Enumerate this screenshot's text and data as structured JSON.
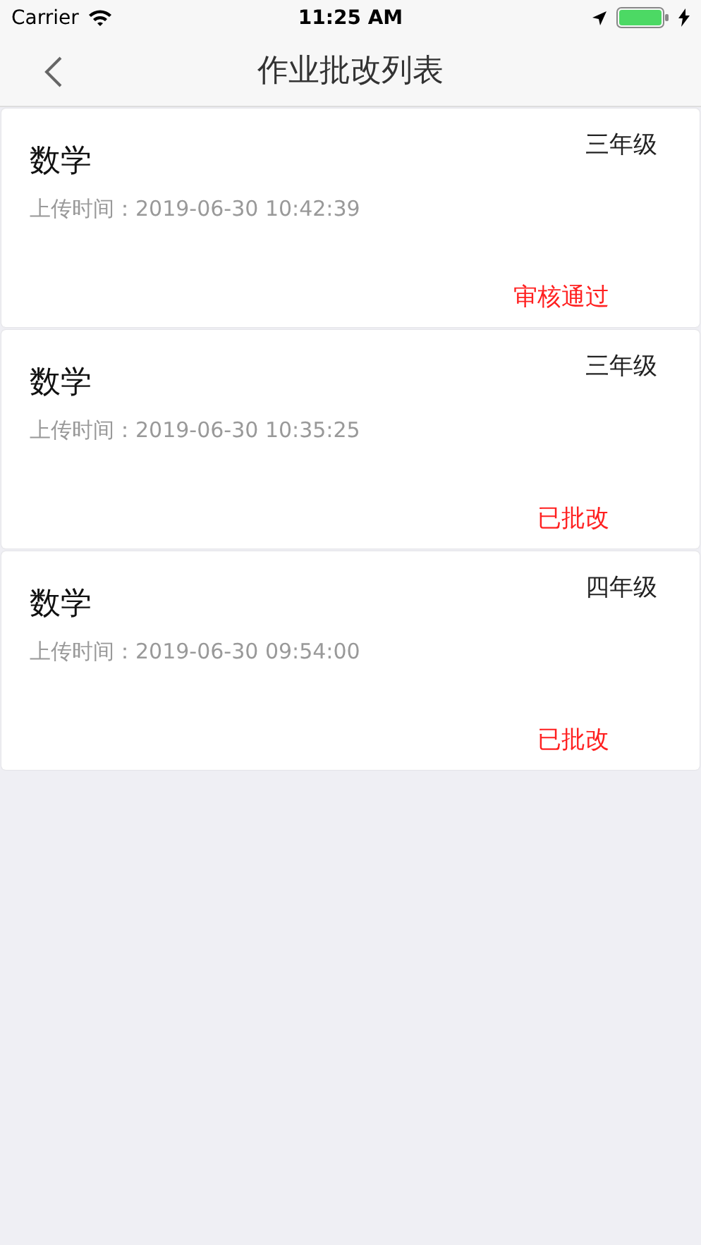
{
  "status_bar": {
    "carrier": "Carrier",
    "time": "11:25 AM"
  },
  "nav": {
    "title": "作业批改列表"
  },
  "items": [
    {
      "subject": "数学",
      "grade": "三年级",
      "upload_time": "上传时间：2019-06-30 10:42:39",
      "status": "审核通过"
    },
    {
      "subject": "数学",
      "grade": "三年级",
      "upload_time": "上传时间：2019-06-30 10:35:25",
      "status": "已批改"
    },
    {
      "subject": "数学",
      "grade": "四年级",
      "upload_time": "上传时间：2019-06-30 09:54:00",
      "status": "已批改"
    }
  ]
}
